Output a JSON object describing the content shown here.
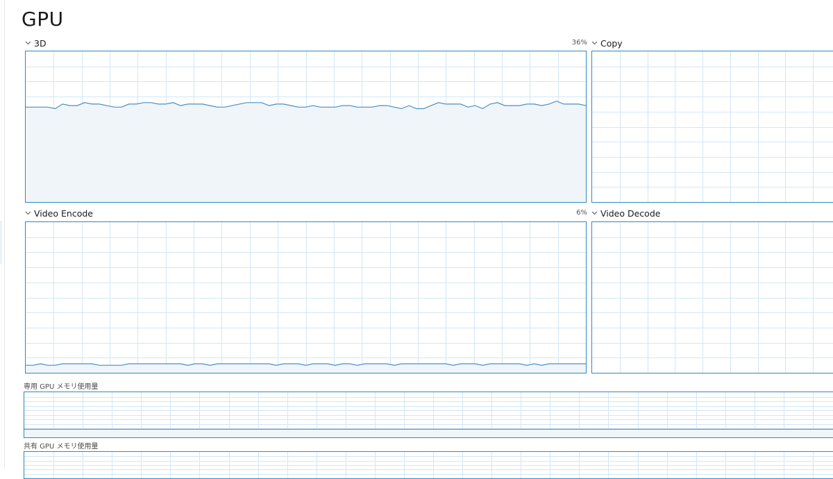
{
  "page": {
    "title": "GPU"
  },
  "engines": {
    "d3": {
      "label": "3D",
      "percent": "36%"
    },
    "copy": {
      "label": "Copy"
    },
    "video_encode": {
      "label": "Video Encode",
      "percent": "6%"
    },
    "video_decode": {
      "label": "Video Decode"
    }
  },
  "memory": {
    "dedicated_label": "専用 GPU メモリ使用量",
    "shared_label": "共有 GPU メモリ使用量"
  },
  "colors": {
    "graph_border": "#2b88c4",
    "grid_line": "#d4e6f3",
    "series_line": "#4a8fc3",
    "series_fill": "#f0f5f9"
  },
  "icons": {
    "collapse": "chevron-down-icon"
  },
  "series": {
    "d3_utilization": [
      63,
      63,
      63,
      63,
      62,
      65,
      64,
      64,
      66,
      65,
      65,
      64,
      63,
      63,
      65,
      65,
      66,
      66,
      65,
      65,
      66,
      64,
      65,
      65,
      65,
      64,
      63,
      63,
      64,
      65,
      66,
      66,
      66,
      64,
      65,
      65,
      64,
      63,
      63,
      64,
      63,
      63,
      63,
      64,
      64,
      63,
      63,
      63,
      64,
      64,
      63,
      62,
      64,
      62,
      62,
      64,
      66,
      65,
      65,
      65,
      63,
      64,
      62,
      65,
      66,
      64,
      64,
      64,
      65,
      65,
      64,
      65,
      67,
      65,
      65,
      65,
      64
    ],
    "video_encode_utilization": [
      5,
      5,
      6,
      5,
      5,
      6,
      6,
      6,
      6,
      6,
      5,
      5,
      5,
      5,
      6,
      6,
      6,
      6,
      6,
      6,
      6,
      6,
      5,
      6,
      6,
      5,
      6,
      6,
      6,
      6,
      6,
      6,
      6,
      6,
      5,
      6,
      6,
      6,
      5,
      6,
      6,
      6,
      5,
      6,
      6,
      5,
      6,
      6,
      6,
      6,
      5,
      6,
      6,
      6,
      6,
      6,
      6,
      6,
      5,
      6,
      6,
      6,
      5,
      6,
      6,
      6,
      6,
      6,
      5,
      6,
      5,
      6,
      6,
      6,
      6,
      6,
      6
    ],
    "dedicated_memory_fraction": 0.18
  }
}
